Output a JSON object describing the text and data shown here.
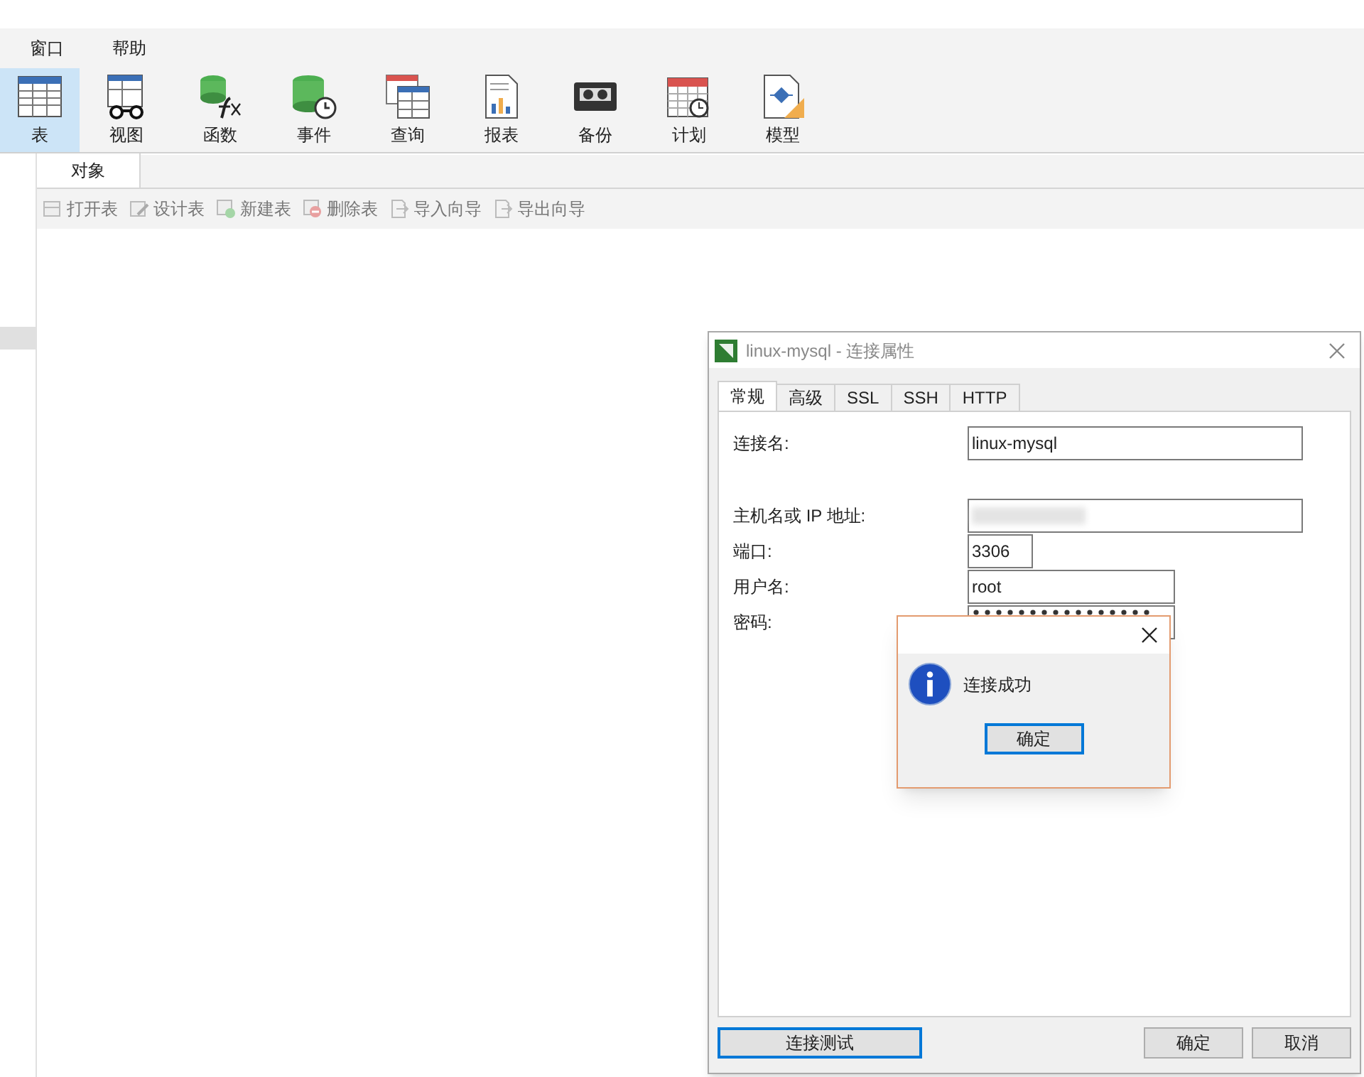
{
  "menu": [
    {
      "label": "窗口"
    },
    {
      "label": "帮助"
    }
  ],
  "toolbar": [
    {
      "label": "表",
      "kind": "table",
      "selected": true
    },
    {
      "label": "视图",
      "kind": "view",
      "selected": false
    },
    {
      "label": "函数",
      "kind": "function",
      "selected": false
    },
    {
      "label": "事件",
      "kind": "event",
      "selected": false
    },
    {
      "label": "查询",
      "kind": "query",
      "selected": false
    },
    {
      "label": "报表",
      "kind": "report",
      "selected": false
    },
    {
      "label": "备份",
      "kind": "backup",
      "selected": false
    },
    {
      "label": "计划",
      "kind": "schedule",
      "selected": false
    },
    {
      "label": "模型",
      "kind": "model",
      "selected": false
    }
  ],
  "object_tabs": [
    {
      "label": "对象",
      "selected": true
    }
  ],
  "actions": [
    {
      "label": "打开表",
      "kind": "open",
      "disabled": true
    },
    {
      "label": "设计表",
      "kind": "design",
      "disabled": true
    },
    {
      "label": "新建表",
      "kind": "new",
      "disabled": true
    },
    {
      "label": "删除表",
      "kind": "delete",
      "disabled": true
    },
    {
      "label": "导入向导",
      "kind": "import",
      "disabled": true
    },
    {
      "label": "导出向导",
      "kind": "export",
      "disabled": true
    }
  ],
  "dialog": {
    "title": "linux-mysql - 连接属性",
    "tabs": [
      {
        "label": "常规",
        "selected": true
      },
      {
        "label": "高级",
        "selected": false
      },
      {
        "label": "SSL",
        "selected": false
      },
      {
        "label": "SSH",
        "selected": false
      },
      {
        "label": "HTTP",
        "selected": false
      }
    ],
    "fields": [
      {
        "kind": "name",
        "label": "连接名:",
        "value": "linux-mysql"
      },
      {
        "kind": "host",
        "label": "主机名或 IP 地址:",
        "redacted": true
      },
      {
        "kind": "port",
        "label": "端口:",
        "value": "3306"
      },
      {
        "kind": "user",
        "label": "用户名:",
        "value": "root"
      },
      {
        "kind": "password",
        "label": "密码:",
        "masked": true
      }
    ],
    "buttons": [
      {
        "label": "连接测试",
        "focused": true
      },
      {
        "label": "确定",
        "focused": false
      },
      {
        "label": "取消",
        "focused": false
      }
    ]
  },
  "message_box": {
    "text": "连接成功",
    "button": {
      "label": "确定",
      "focused": true
    }
  }
}
